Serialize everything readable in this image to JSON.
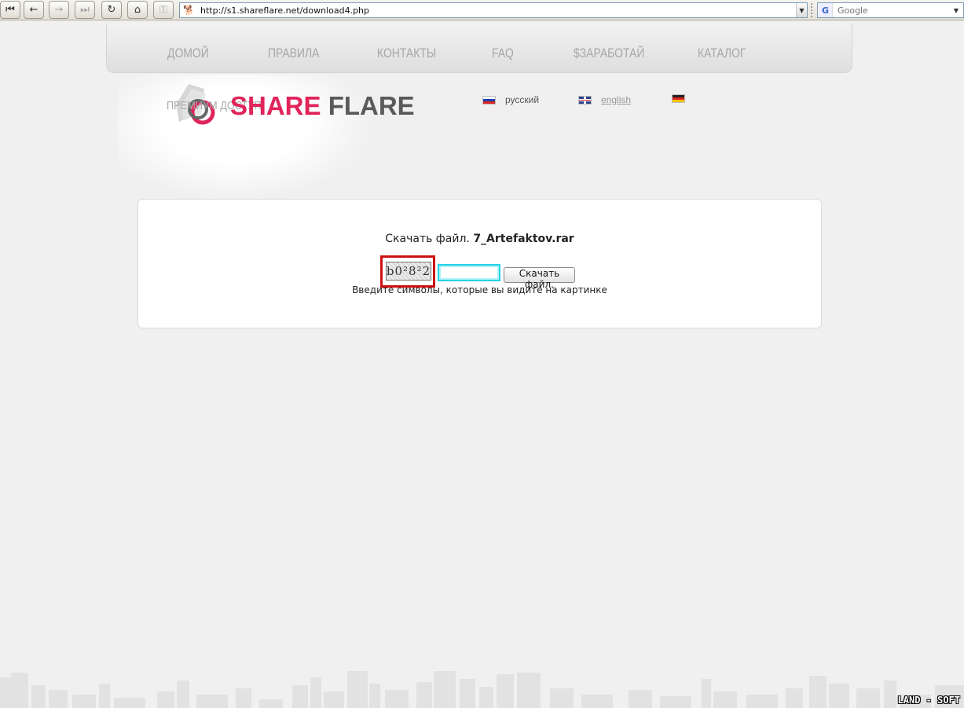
{
  "browser": {
    "url": "http://s1.shareflare.net/download4.php",
    "search_placeholder": "Google",
    "buttons": [
      {
        "name": "first-page-button",
        "icon": "skip-back-icon",
        "glyph": "⏮",
        "disabled": false
      },
      {
        "name": "back-button",
        "icon": "back-arrow-icon",
        "glyph": "←",
        "disabled": false
      },
      {
        "name": "forward-button",
        "icon": "forward-arrow-icon",
        "glyph": "→",
        "disabled": true
      },
      {
        "name": "last-page-button",
        "icon": "skip-forward-icon",
        "glyph": "⏭",
        "disabled": true
      },
      {
        "name": "reload-button",
        "icon": "reload-icon",
        "glyph": "↻",
        "disabled": false
      },
      {
        "name": "home-button",
        "icon": "home-icon",
        "glyph": "⌂",
        "disabled": false
      },
      {
        "name": "key-button",
        "icon": "key-icon",
        "glyph": "⚿",
        "disabled": true
      }
    ]
  },
  "nav": {
    "items": [
      "ДОМОЙ",
      "ПРАВИЛА",
      "КОНТАКТЫ",
      "FAQ",
      "$ЗАРАБОТАЙ",
      "КАТАЛОГ"
    ]
  },
  "premium_link": "ПРЕМИУМ ДОСТУП",
  "logo": {
    "share": "SHARE",
    "flare": "FLARE"
  },
  "languages": {
    "russian": "русский",
    "english": "english"
  },
  "download": {
    "prefix": "Скачать файл.",
    "filename": "7_Artefaktov.rar",
    "captcha_text": "b0²8²2",
    "code_value": "",
    "button_label": "Скачать файл.",
    "hint": "Введите символы, которые вы видите на картинке"
  },
  "watermark": "LAND - SOFT",
  "colors": {
    "brand_pink": "#e0255b",
    "highlight_red": "#cc1111",
    "input_cyan": "#22d3e8"
  }
}
